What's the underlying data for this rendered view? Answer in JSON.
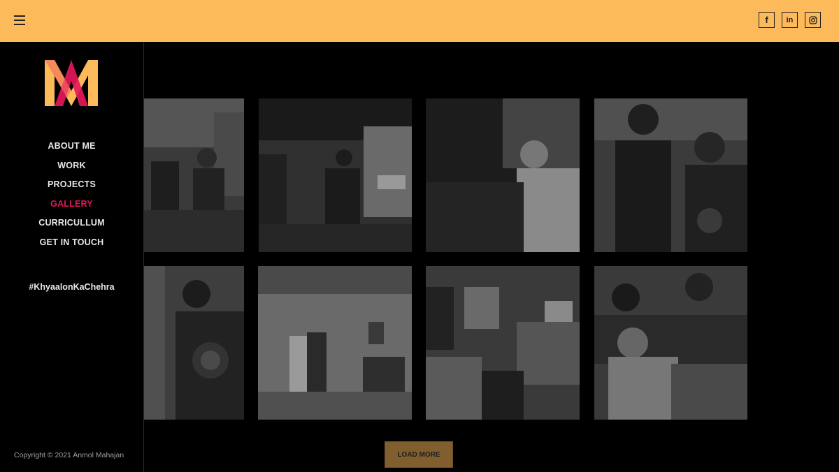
{
  "header": {
    "menu_icon": "hamburger-menu-icon",
    "social": [
      {
        "icon": "facebook-icon",
        "glyph": "f"
      },
      {
        "icon": "linkedin-icon",
        "glyph": "in"
      },
      {
        "icon": "instagram-icon",
        "glyph": ""
      }
    ]
  },
  "sidebar": {
    "logo_icon": "anmol-mahajan-logo",
    "nav": [
      {
        "label": "ABOUT ME"
      },
      {
        "label": "WORK"
      },
      {
        "label": "PROJECTS"
      },
      {
        "label": "GALLERY",
        "active": true
      },
      {
        "label": "CURRICULLUM"
      },
      {
        "label": "GET IN TOUCH"
      }
    ],
    "hashtag": "#KhyaalonKaChehra",
    "copyright": "Copyright © 2021 Anmol Mahajan"
  },
  "gallery": {
    "load_more_label": "LOAD MORE"
  },
  "colors": {
    "topbar": "#fdba5a",
    "active_nav": "#e5185a",
    "logo_yellow": "#fdba5a",
    "logo_pink": "#e5185a",
    "load_more_bg": "#805e2e"
  }
}
